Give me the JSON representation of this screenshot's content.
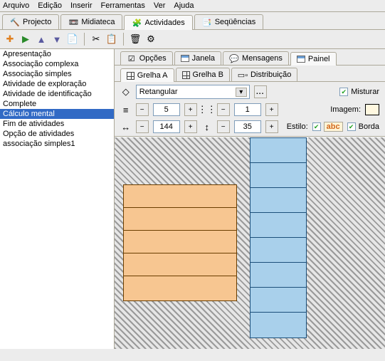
{
  "menu": {
    "file": "Arquivo",
    "edit": "Edição",
    "insert": "Inserir",
    "tools": "Ferramentas",
    "view": "Ver",
    "help": "Ajuda"
  },
  "tabs": {
    "project": "Projecto",
    "media": "Midiateca",
    "activities": "Actividades",
    "sequences": "Seqüências"
  },
  "activity_list": [
    "Apresentação",
    "Associação complexa",
    "Associação simples",
    "Atividade de exploração",
    "Atividade de identificação",
    "Complete",
    "Cálculo mental",
    "Fim de atividades",
    "Opção de atividades",
    "associação simples1"
  ],
  "selected_index": 6,
  "panel_tabs": {
    "options": "Opções",
    "window": "Janela",
    "messages": "Mensagens",
    "panel": "Painel"
  },
  "grid_tabs": {
    "grid_a": "Grelha A",
    "grid_b": "Grelha B",
    "layout": "Distribuição"
  },
  "controls": {
    "shape_icon": "◇",
    "shape_value": "Retangular",
    "browse": "...",
    "shuffle_label": "Misturar",
    "shuffle_checked": "✔",
    "rows_icon": "≡",
    "rows_value": "5",
    "cols_icon": "⋮⋮",
    "cols_value": "1",
    "image_label": "Imagem:",
    "width_icon": "↔",
    "width_value": "144",
    "height_icon": "↕",
    "height_value": "35",
    "style_label": "Estilo:",
    "style_checked": "✔",
    "style_abc": "abc",
    "border_label": "Borda",
    "border_checked": "✔",
    "minus": "−",
    "plus": "+"
  },
  "icons": {
    "proj": "🔨",
    "media": "📼",
    "act": "🧩",
    "seq": "📑",
    "add": "✚",
    "play": "▶",
    "up": "▲",
    "down": "▼",
    "copy": "📄",
    "cut": "✂",
    "paste": "📋",
    "delete": "🗑",
    "props": "⚙"
  }
}
